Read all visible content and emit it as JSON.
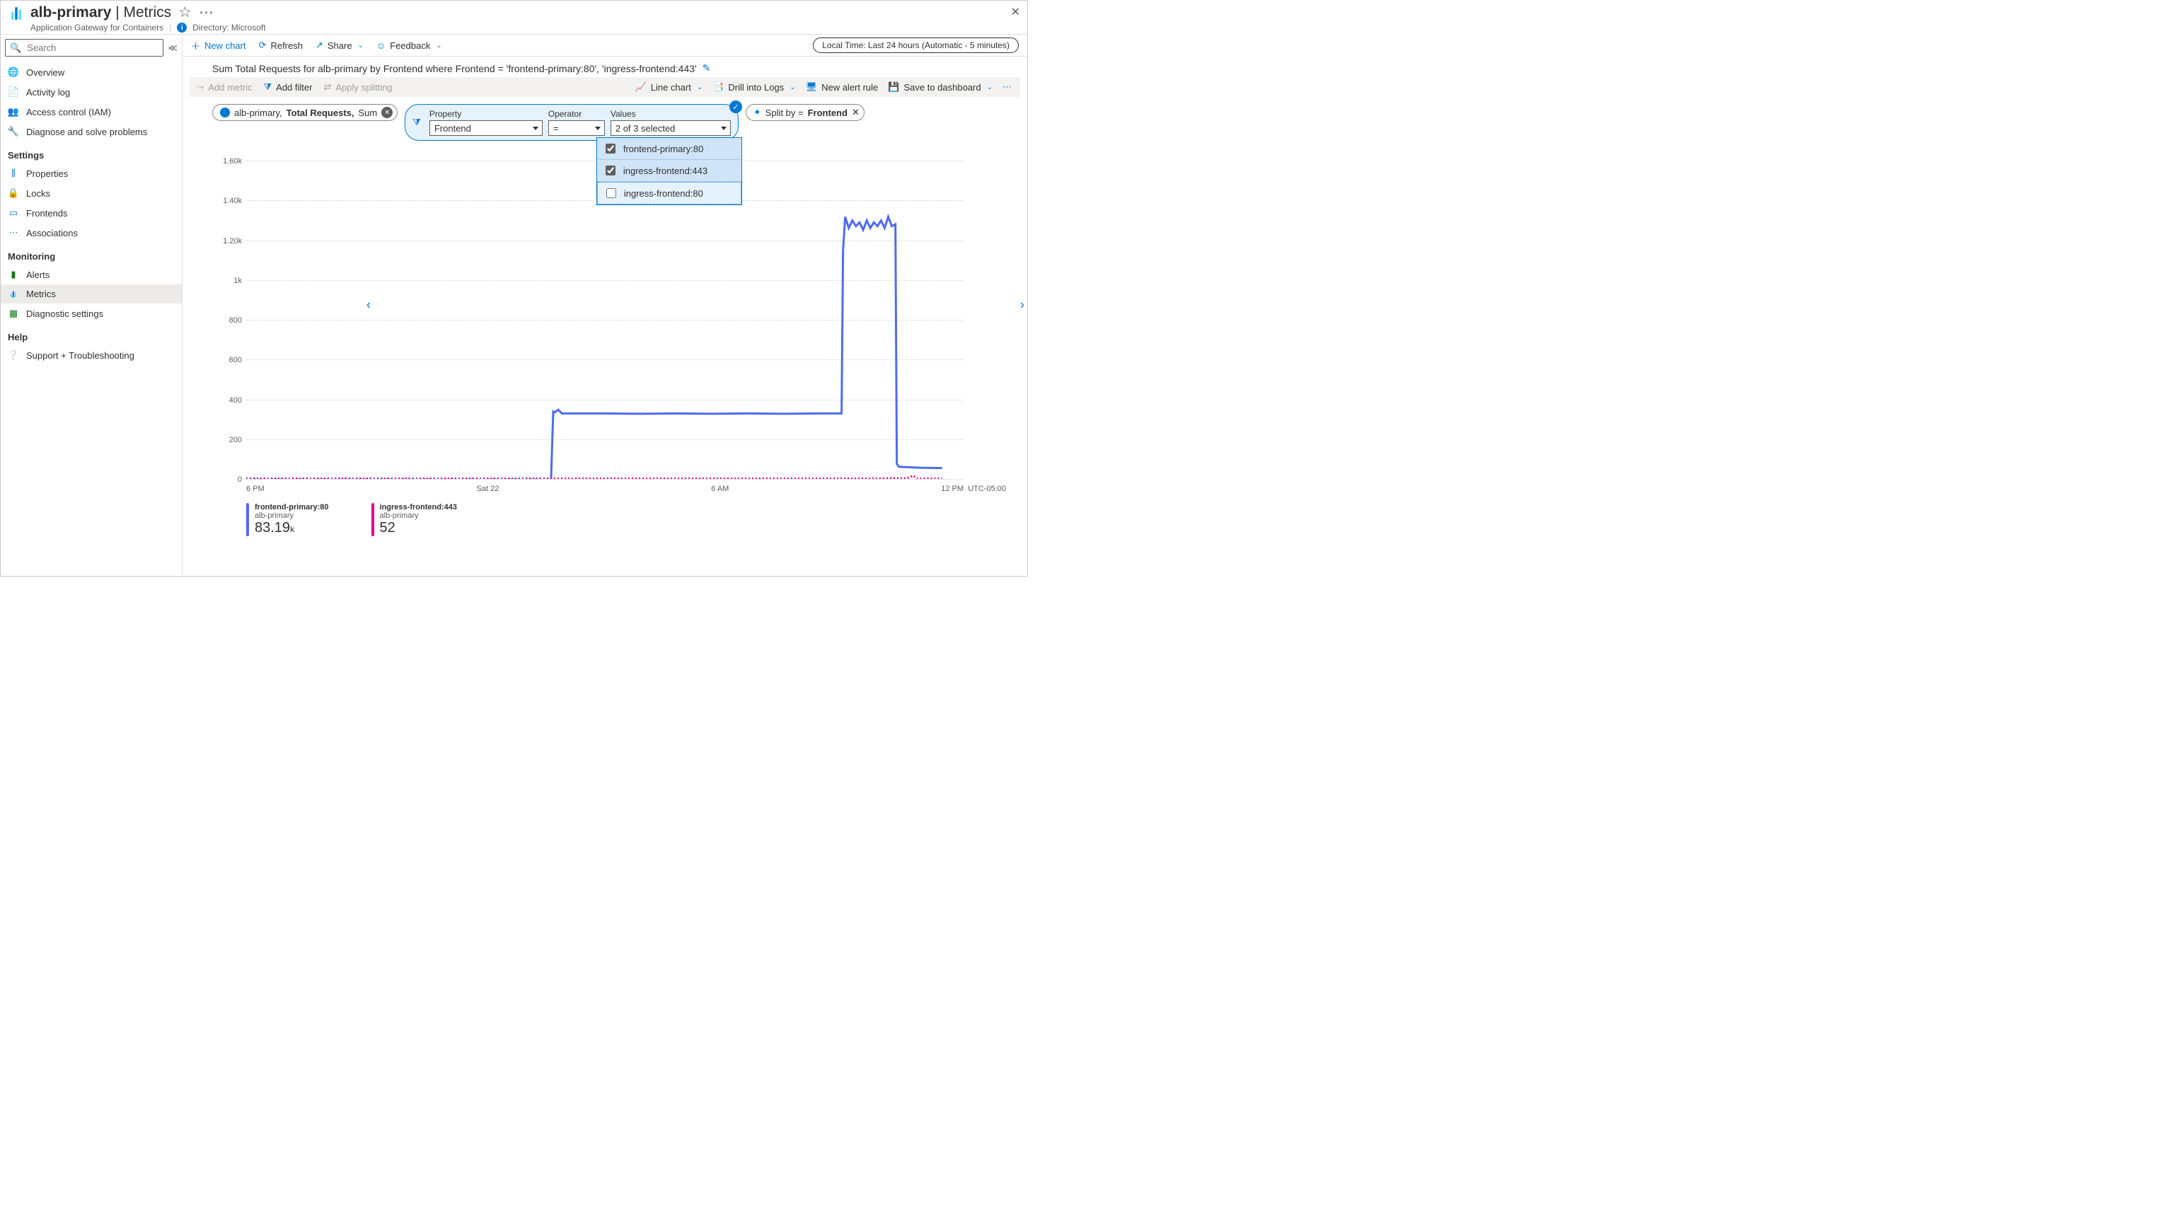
{
  "header": {
    "resource_name": "alb-primary",
    "page_name": "Metrics",
    "subtitle_type": "Application Gateway for Containers",
    "directory_label": "Directory: Microsoft"
  },
  "sidebar": {
    "search_placeholder": "Search",
    "items": {
      "overview": "Overview",
      "activity": "Activity log",
      "iam": "Access control (IAM)",
      "diagnose": "Diagnose and solve problems"
    },
    "settings_label": "Settings",
    "settings": {
      "properties": "Properties",
      "locks": "Locks",
      "frontends": "Frontends",
      "associations": "Associations"
    },
    "monitoring_label": "Monitoring",
    "monitoring": {
      "alerts": "Alerts",
      "metrics": "Metrics",
      "diag": "Diagnostic settings"
    },
    "help_label": "Help",
    "help": {
      "support": "Support + Troubleshooting"
    }
  },
  "commands": {
    "new_chart": "New chart",
    "refresh": "Refresh",
    "share": "Share",
    "feedback": "Feedback",
    "time_range": "Local Time: Last 24 hours (Automatic - 5 minutes)",
    "add_metric": "Add metric",
    "add_filter": "Add filter",
    "apply_splitting": "Apply splitting",
    "line_chart": "Line chart",
    "drill_logs": "Drill into Logs",
    "new_alert": "New alert rule",
    "save_dash": "Save to dashboard"
  },
  "chart_title": "Sum Total Requests for alb-primary by Frontend where Frontend = 'frontend-primary:80', 'ingress-frontend:443'",
  "metric_pill": {
    "resource": "alb-primary,",
    "metric": "Total Requests,",
    "aggregation": "Sum"
  },
  "filter": {
    "property_label": "Property",
    "operator_label": "Operator",
    "values_label": "Values",
    "property_value": "Frontend",
    "operator_value": "=",
    "values_display": "2 of 3 selected",
    "options": [
      {
        "label": "frontend-primary:80",
        "checked": true
      },
      {
        "label": "ingress-frontend:443",
        "checked": true
      },
      {
        "label": "ingress-frontend:80",
        "checked": false
      }
    ]
  },
  "split": {
    "prefix": "Split by =",
    "value": "Frontend"
  },
  "chart_data": {
    "type": "line",
    "ylim": [
      0,
      1700
    ],
    "y_ticks": [
      "1.60k",
      "1.40k",
      "1.20k",
      "1k",
      "800",
      "600",
      "400",
      "200",
      "0"
    ],
    "x_ticks": [
      "6 PM",
      "Sat 22",
      "6 AM",
      "12 PM"
    ],
    "timezone": "UTC-05:00",
    "x_range_hours": 24,
    "series": [
      {
        "name": "frontend-primary:80",
        "resource": "alb-primary",
        "color": "#4f6bed",
        "latest_value": "83.19",
        "latest_unit": "k",
        "points": [
          [
            0.0,
            null
          ],
          [
            0.42,
            null
          ],
          [
            0.425,
            0
          ],
          [
            0.428,
            360
          ],
          [
            0.43,
            355
          ],
          [
            0.435,
            370
          ],
          [
            0.44,
            350
          ],
          [
            0.46,
            350
          ],
          [
            0.5,
            350
          ],
          [
            0.55,
            348
          ],
          [
            0.6,
            350
          ],
          [
            0.65,
            348
          ],
          [
            0.7,
            350
          ],
          [
            0.75,
            348
          ],
          [
            0.8,
            350
          ],
          [
            0.83,
            350
          ],
          [
            0.832,
            1220
          ],
          [
            0.835,
            1400
          ],
          [
            0.84,
            1340
          ],
          [
            0.845,
            1380
          ],
          [
            0.85,
            1350
          ],
          [
            0.855,
            1370
          ],
          [
            0.86,
            1330
          ],
          [
            0.865,
            1380
          ],
          [
            0.87,
            1340
          ],
          [
            0.875,
            1370
          ],
          [
            0.88,
            1350
          ],
          [
            0.885,
            1380
          ],
          [
            0.89,
            1340
          ],
          [
            0.895,
            1400
          ],
          [
            0.9,
            1350
          ],
          [
            0.905,
            1360
          ],
          [
            0.907,
            80
          ],
          [
            0.91,
            65
          ],
          [
            0.94,
            60
          ],
          [
            0.97,
            58
          ]
        ]
      },
      {
        "name": "ingress-frontend:443",
        "resource": "alb-primary",
        "color": "#e3008c",
        "latest_value": "52",
        "latest_unit": "",
        "points": [
          [
            0.0,
            2
          ],
          [
            0.1,
            2
          ],
          [
            0.2,
            2
          ],
          [
            0.3,
            2
          ],
          [
            0.4,
            2
          ],
          [
            0.5,
            2
          ],
          [
            0.6,
            2
          ],
          [
            0.7,
            2
          ],
          [
            0.8,
            2
          ],
          [
            0.88,
            2
          ],
          [
            0.9,
            4
          ],
          [
            0.92,
            2
          ],
          [
            0.93,
            18
          ],
          [
            0.935,
            2
          ],
          [
            0.95,
            2
          ],
          [
            0.97,
            2
          ]
        ]
      }
    ]
  }
}
